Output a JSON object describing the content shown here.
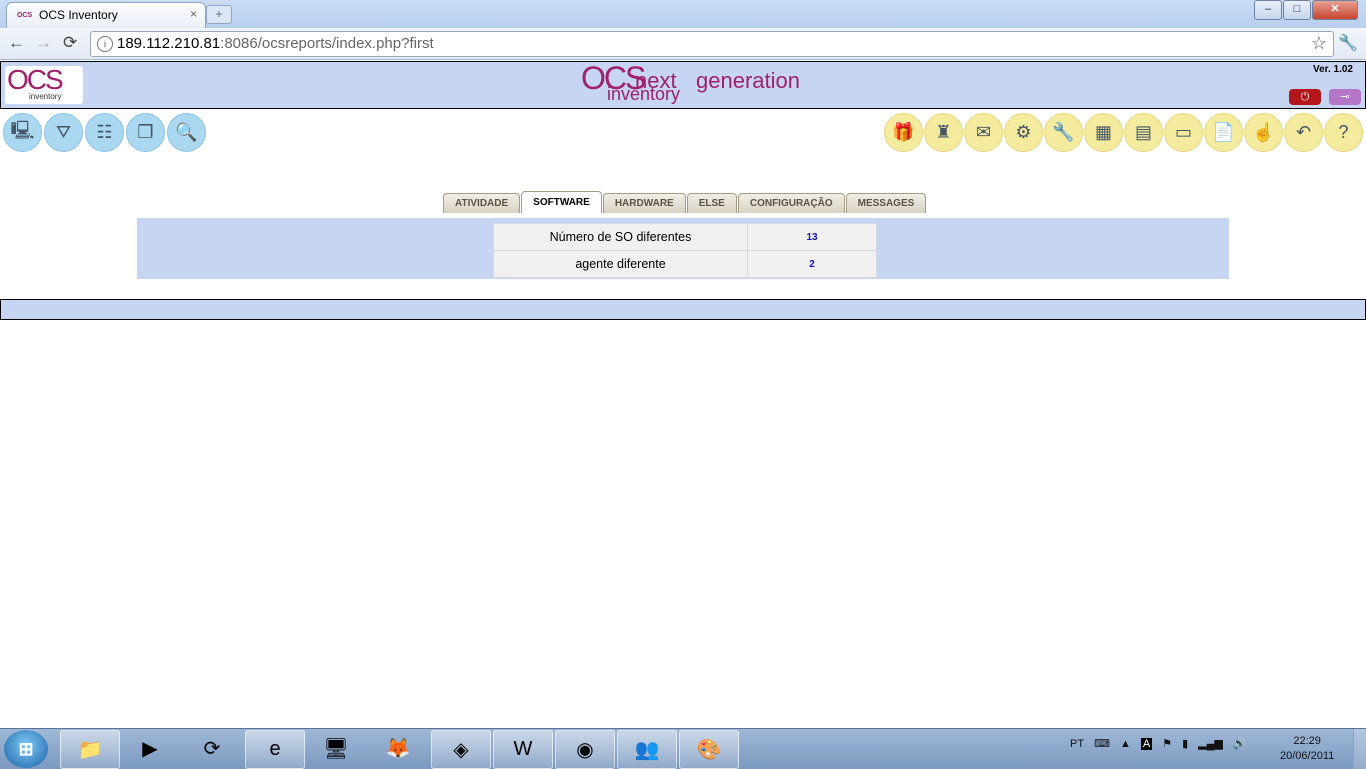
{
  "browser": {
    "tab_title": "OCS Inventory",
    "tab_favicon_text": "OCS",
    "tab_close": "×",
    "newtab": "+",
    "url_host": "189.112.210.81",
    "url_rest": ":8086/ocsreports/index.php?first",
    "win_minimize": "–",
    "win_maximize": "□",
    "win_close": "✕",
    "back": "←",
    "forward": "→",
    "reload": "⟳",
    "star": "☆",
    "wrench": "🔧",
    "page_icon": "i"
  },
  "header": {
    "logo_big": "OCS",
    "logo_small": "inventory",
    "banner_ocs": "OCS",
    "banner_next": "next",
    "banner_generation": "generation",
    "banner_inventory": "inventory",
    "version": "Ver. 1.02",
    "power_glyph": "⏻",
    "key_glyph": "⊸"
  },
  "icons_left": [
    {
      "name": "computers-icon",
      "glyph": "🖳"
    },
    {
      "name": "filter-icon",
      "glyph": "⛛"
    },
    {
      "name": "network-icon",
      "glyph": "☷"
    },
    {
      "name": "groups-icon",
      "glyph": "❐"
    },
    {
      "name": "search-icon",
      "glyph": "🔍"
    }
  ],
  "icons_right": [
    {
      "name": "package-icon",
      "glyph": "🎁"
    },
    {
      "name": "firewall-icon",
      "glyph": "♜"
    },
    {
      "name": "snmp-icon",
      "glyph": "✉"
    },
    {
      "name": "settings-icon",
      "glyph": "⚙"
    },
    {
      "name": "tools-icon",
      "glyph": "🔧"
    },
    {
      "name": "dictionary-icon",
      "glyph": "▦"
    },
    {
      "name": "registry-icon",
      "glyph": "▤"
    },
    {
      "name": "label-icon",
      "glyph": "▭"
    },
    {
      "name": "document-icon",
      "glyph": "📄"
    },
    {
      "name": "users-icon",
      "glyph": "☝"
    },
    {
      "name": "logout-icon",
      "glyph": "↶"
    },
    {
      "name": "help-icon",
      "glyph": "?"
    }
  ],
  "tabs": [
    "ATIVIDADE",
    "SOFTWARE",
    "HARDWARE",
    "ELSE",
    "CONFIGURAÇÃO",
    "MESSAGES"
  ],
  "active_tab": "SOFTWARE",
  "stats": [
    {
      "label": "Número de SO diferentes",
      "value": "13"
    },
    {
      "label": "agente diferente",
      "value": "2"
    }
  ],
  "taskbar": {
    "start": "⊞",
    "apps": [
      {
        "name": "explorer-icon",
        "glyph": "📁",
        "pinned": true
      },
      {
        "name": "media-player-icon",
        "glyph": "▶",
        "pinned": false
      },
      {
        "name": "sync-icon",
        "glyph": "⟳",
        "pinned": false
      },
      {
        "name": "internet-explorer-icon",
        "glyph": "e",
        "pinned": true
      },
      {
        "name": "network-computer-icon",
        "glyph": "🖥",
        "pinned": false
      },
      {
        "name": "firefox-icon",
        "glyph": "🦊",
        "pinned": false
      },
      {
        "name": "virtualbox-icon",
        "glyph": "◈",
        "pinned": true
      },
      {
        "name": "word-icon",
        "glyph": "W",
        "pinned": true
      },
      {
        "name": "chrome-icon",
        "glyph": "◉",
        "pinned": true
      },
      {
        "name": "messenger-icon",
        "glyph": "👥",
        "pinned": true
      },
      {
        "name": "paint-icon",
        "glyph": "🎨",
        "pinned": true
      }
    ],
    "lang": "PT",
    "keyboard_glyph": "⌨",
    "arrow_glyph": "▲",
    "ime_glyph": "A",
    "flag_glyph": "⚑",
    "power_glyph": "▮",
    "signal_glyph": "▂▄▆",
    "volume_glyph": "🔊",
    "time": "22:29",
    "date": "20/06/2011"
  }
}
